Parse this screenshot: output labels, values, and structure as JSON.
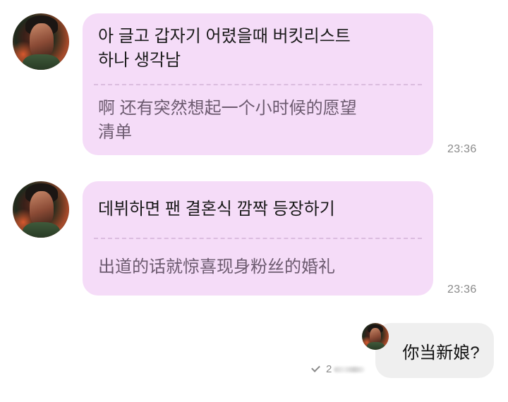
{
  "messages": [
    {
      "ko_lines": [
        "아 글고 갑자기 어렸을때 버킷리스트",
        "하나 생각남"
      ],
      "zh_lines": [
        "啊 还有突然想起一个小时候的愿望",
        "清单"
      ],
      "time": "23:36"
    },
    {
      "ko_lines": [
        "데뷔하면 팬 결혼식 깜짝 등장하기"
      ],
      "zh_lines": [
        "出道的话就惊喜现身粉丝的婚礼"
      ],
      "time": "23:36"
    }
  ],
  "reply": {
    "text": "你当新娘?",
    "read_count": "2"
  },
  "colors": {
    "incoming_bubble": "#f5dcf8",
    "outgoing_bubble": "#efefef",
    "translation_text": "#6c5a6f",
    "timestamp": "#8a8a8a"
  },
  "icons": {
    "read_receipt": "check-icon"
  }
}
